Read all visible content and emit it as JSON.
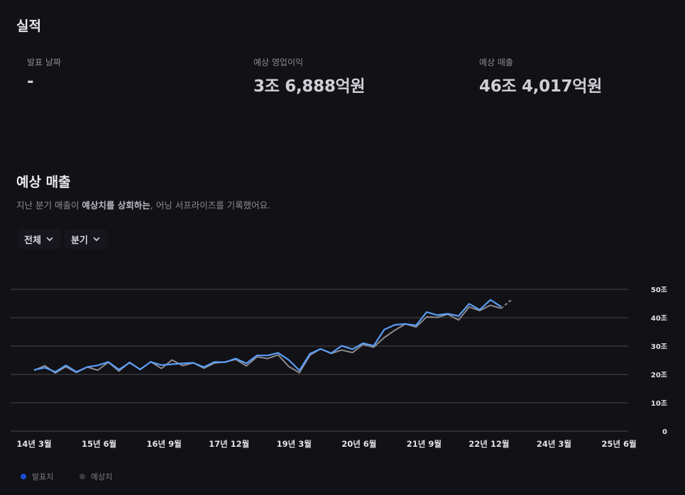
{
  "results": {
    "title": "실적",
    "announce_label": "발표 날짜",
    "announce_value": "-",
    "op_income_label": "예상 영업이익",
    "op_income_value": "3조 6,888억원",
    "revenue_label": "예상 매출",
    "revenue_value": "46조 4,017억원"
  },
  "revenue_section": {
    "title": "예상 매출",
    "desc_prefix": "지난 분기 매출이 ",
    "desc_bold": "예상치를 상회하는",
    "desc_suffix": ", 어닝 서프라이즈를 기록했어요."
  },
  "filters": {
    "range": "전체",
    "period": "분기"
  },
  "legend": {
    "reported": "발표치",
    "estimate": "예상치"
  },
  "colors": {
    "reported": "#5b9ef5",
    "estimate": "#8a8a90",
    "grid": "#46464c",
    "background": "#111116"
  },
  "chart_data": {
    "type": "line",
    "ylim": [
      0,
      50
    ],
    "ytick_values": [
      0,
      10,
      20,
      30,
      40,
      50
    ],
    "ytick_labels": [
      "0",
      "10조",
      "20조",
      "30조",
      "40조",
      "50조"
    ],
    "xtick_labels": [
      "14년 3월",
      "15년 6월",
      "16년 9월",
      "17년 12월",
      "19년 3월",
      "20년 6월",
      "21년 9월",
      "22년 12월",
      "24년 3월",
      "25년 6월"
    ],
    "x": [
      "14.3",
      "14.6",
      "14.9",
      "14.12",
      "15.3",
      "15.6",
      "15.9",
      "15.12",
      "16.3",
      "16.6",
      "16.9",
      "16.12",
      "17.3",
      "17.6",
      "17.9",
      "17.12",
      "18.3",
      "18.6",
      "18.9",
      "18.12",
      "19.3",
      "19.6",
      "19.9",
      "19.12",
      "20.3",
      "20.6",
      "20.9",
      "20.12",
      "21.3",
      "21.6",
      "21.9",
      "21.12",
      "22.3",
      "22.6",
      "22.9",
      "22.12",
      "23.3",
      "23.6",
      "23.9",
      "23.12",
      "24.3",
      "24.6",
      "24.9",
      "24.12",
      "25.3",
      "25.6"
    ],
    "series": [
      {
        "name": "발표치",
        "values": [
          21.6,
          22.4,
          20.9,
          23.2,
          20.9,
          22.6,
          23.2,
          24.4,
          21.7,
          24.1,
          21.8,
          24.4,
          23.3,
          23.6,
          23.9,
          24.1,
          22.6,
          24.4,
          24.3,
          25.6,
          23.9,
          26.7,
          26.7,
          27.6,
          25.1,
          21.4,
          27.3,
          29.0,
          27.5,
          30.1,
          28.9,
          31.0,
          30.1,
          35.8,
          37.5,
          37.8,
          37.3,
          42.0,
          40.9,
          41.4,
          40.6,
          44.9,
          42.8,
          46.3,
          43.9,
          null
        ]
      },
      {
        "name": "예상치",
        "values": [
          21.4,
          23.1,
          20.5,
          22.7,
          20.7,
          22.6,
          21.5,
          24.3,
          21.2,
          24.3,
          21.7,
          24.5,
          22.1,
          25.1,
          23.1,
          24.1,
          22.2,
          24.0,
          24.4,
          25.3,
          23.0,
          26.2,
          25.6,
          26.9,
          22.8,
          20.6,
          26.8,
          29.0,
          27.4,
          28.6,
          27.7,
          30.6,
          29.6,
          33.0,
          35.6,
          37.8,
          36.7,
          40.3,
          40.1,
          41.2,
          39.2,
          43.8,
          42.5,
          44.4,
          43.3,
          46.4
        ]
      }
    ]
  }
}
